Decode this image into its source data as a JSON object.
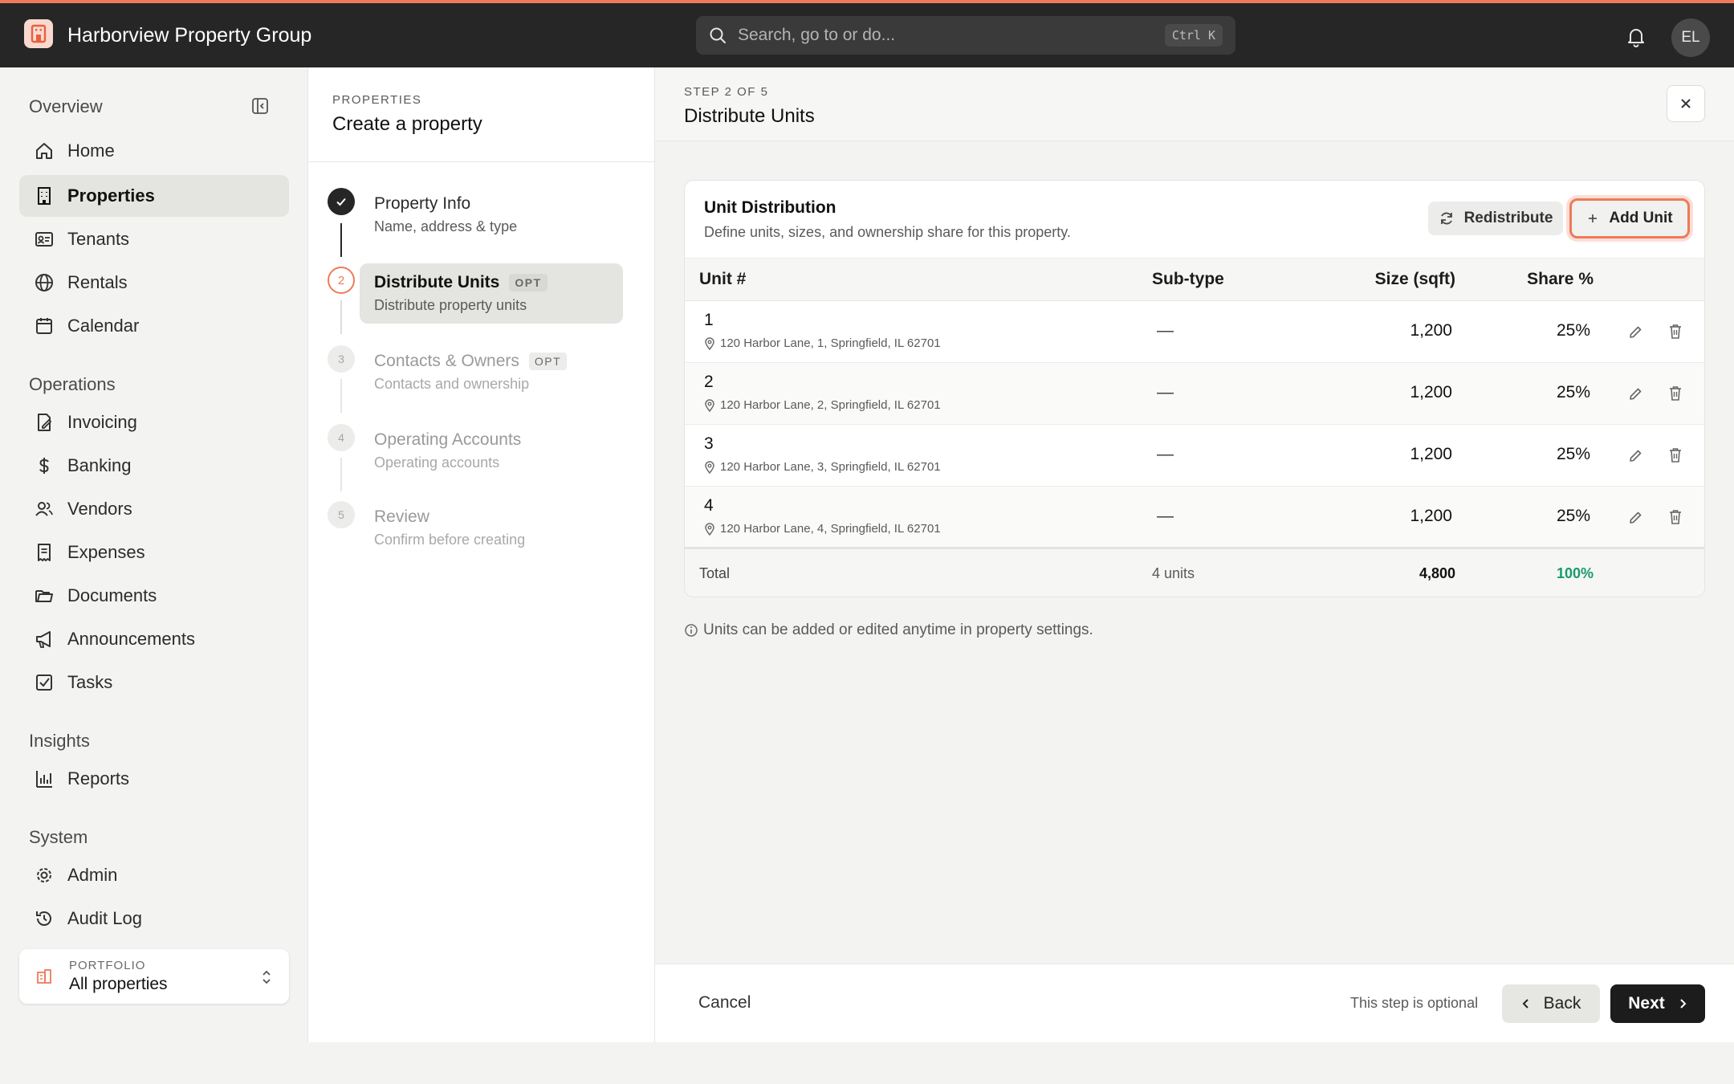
{
  "app": {
    "name": "Harborview Property Group"
  },
  "search": {
    "placeholder": "Search, go to or do...",
    "shortcut": "Ctrl K"
  },
  "user": {
    "initials": "EL"
  },
  "sidebar": {
    "overview_label": "Overview",
    "sections": [
      "Operations",
      "Insights",
      "System"
    ],
    "items": [
      {
        "label": "Home",
        "icon": "home-icon"
      },
      {
        "label": "Properties",
        "icon": "building-icon",
        "active": true
      },
      {
        "label": "Tenants",
        "icon": "id-card-icon"
      },
      {
        "label": "Rentals",
        "icon": "globe-icon"
      },
      {
        "label": "Calendar",
        "icon": "calendar-icon"
      },
      {
        "label": "Invoicing",
        "icon": "invoice-icon"
      },
      {
        "label": "Banking",
        "icon": "dollar-icon"
      },
      {
        "label": "Vendors",
        "icon": "users-icon"
      },
      {
        "label": "Expenses",
        "icon": "receipt-icon"
      },
      {
        "label": "Documents",
        "icon": "folder-icon"
      },
      {
        "label": "Announcements",
        "icon": "megaphone-icon"
      },
      {
        "label": "Tasks",
        "icon": "checkbox-icon"
      },
      {
        "label": "Reports",
        "icon": "bar-chart-icon"
      },
      {
        "label": "Admin",
        "icon": "gear-icon"
      },
      {
        "label": "Audit Log",
        "icon": "history-icon"
      }
    ],
    "portfolio": {
      "label": "PORTFOLIO",
      "value": "All properties"
    }
  },
  "wizard": {
    "kicker": "PROPERTIES",
    "title": "Create a property",
    "steps": [
      {
        "number": "1",
        "title": "Property Info",
        "subtitle": "Name, address & type",
        "status": "done"
      },
      {
        "number": "2",
        "title": "Distribute Units",
        "subtitle": "Distribute property units",
        "status": "current",
        "badge": "OPT"
      },
      {
        "number": "3",
        "title": "Contacts & Owners",
        "subtitle": "Contacts and ownership",
        "status": "todo",
        "badge": "OPT"
      },
      {
        "number": "4",
        "title": "Operating Accounts",
        "subtitle": "Operating accounts",
        "status": "todo"
      },
      {
        "number": "5",
        "title": "Review",
        "subtitle": "Confirm before creating",
        "status": "todo"
      }
    ]
  },
  "main": {
    "step_label": "STEP 2 OF 5",
    "title": "Distribute Units",
    "card": {
      "title": "Unit Distribution",
      "subtitle": "Define units, sizes, and ownership share for this property.",
      "redistribute_label": "Redistribute",
      "add_unit_label": "Add Unit",
      "columns": [
        "Unit #",
        "Sub-type",
        "Size (sqft)",
        "Share %"
      ],
      "rows": [
        {
          "unit": "1",
          "address": "120 Harbor Lane, 1, Springfield, IL 62701",
          "subtype": "—",
          "size": "1,200",
          "share": "25%"
        },
        {
          "unit": "2",
          "address": "120 Harbor Lane, 2, Springfield, IL 62701",
          "subtype": "—",
          "size": "1,200",
          "share": "25%"
        },
        {
          "unit": "3",
          "address": "120 Harbor Lane, 3, Springfield, IL 62701",
          "subtype": "—",
          "size": "1,200",
          "share": "25%"
        },
        {
          "unit": "4",
          "address": "120 Harbor Lane, 4, Springfield, IL 62701",
          "subtype": "—",
          "size": "1,200",
          "share": "25%"
        }
      ],
      "total": {
        "label": "Total",
        "units": "4 units",
        "size": "4,800",
        "share": "100%"
      }
    },
    "note": "Units can be added or edited anytime in property settings.",
    "footer": {
      "cancel_label": "Cancel",
      "optional_text": "This step is optional",
      "back_label": "Back",
      "next_label": "Next"
    }
  },
  "colors": {
    "accent": "#ee7a5a",
    "topbar": "#262626",
    "success": "#1a9a6c"
  }
}
